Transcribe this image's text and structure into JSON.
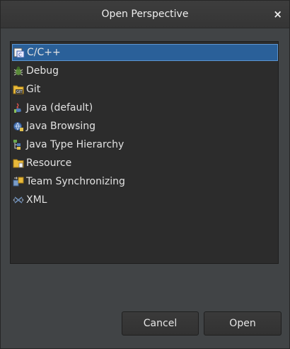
{
  "dialog": {
    "title": "Open Perspective",
    "close_glyph": "×"
  },
  "perspectives": {
    "items": [
      {
        "label": "C/C++",
        "icon": "cpp-perspective-icon",
        "selected": true
      },
      {
        "label": "Debug",
        "icon": "debug-bug-icon",
        "selected": false
      },
      {
        "label": "Git",
        "icon": "git-icon",
        "selected": false
      },
      {
        "label": "Java (default)",
        "icon": "java-icon",
        "selected": false
      },
      {
        "label": "Java Browsing",
        "icon": "java-browsing-icon",
        "selected": false
      },
      {
        "label": "Java Type Hierarchy",
        "icon": "type-hierarchy-icon",
        "selected": false
      },
      {
        "label": "Resource",
        "icon": "resource-folder-icon",
        "selected": false
      },
      {
        "label": "Team Synchronizing",
        "icon": "team-sync-icon",
        "selected": false
      },
      {
        "label": "XML",
        "icon": "xml-icon",
        "selected": false
      }
    ]
  },
  "buttons": {
    "cancel_label": "Cancel",
    "open_label": "Open"
  },
  "colors": {
    "selection": "#2a6099",
    "list_background": "#2c2c2c",
    "dialog_background": "#414446"
  }
}
